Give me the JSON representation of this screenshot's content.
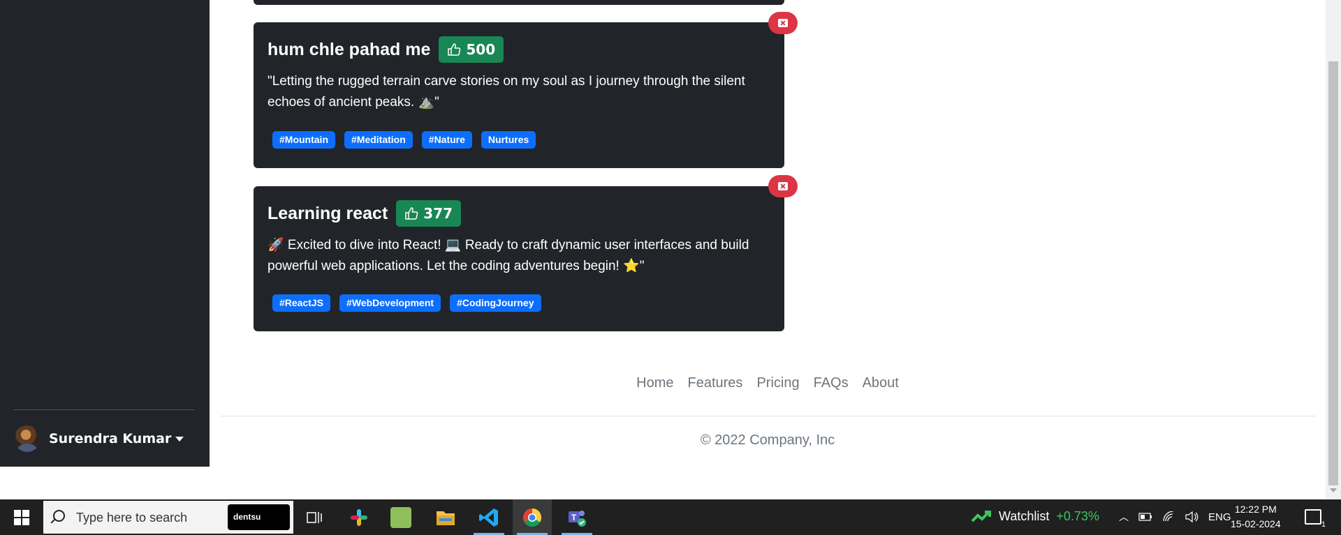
{
  "user": {
    "name": "Surendra Kumar"
  },
  "posts": [
    {
      "title": "hum chle pahad me",
      "likes": "500",
      "body": "\"Letting the rugged terrain carve stories on my soul as I journey through the silent echoes of ancient peaks. ⛰️\"",
      "tags": [
        "#Mountain",
        "#Meditation",
        "#Nature",
        "Nurtures"
      ]
    },
    {
      "title": "Learning react",
      "likes": "377",
      "body": "🚀 Excited to dive into React! 💻 Ready to craft dynamic user interfaces and build powerful web applications. Let the coding adventures begin! ⭐\"",
      "tags": [
        "#ReactJS",
        "#WebDevelopment",
        "#CodingJourney"
      ]
    }
  ],
  "footer": {
    "links": [
      "Home",
      "Features",
      "Pricing",
      "FAQs",
      "About"
    ],
    "copyright": "© 2022 Company, Inc"
  },
  "taskbar": {
    "search_placeholder": "Type here to search",
    "search_brand": "dentsu",
    "watchlist_label": "Watchlist",
    "watchlist_change": "+0.73%",
    "language": "ENG",
    "time": "12:22 PM",
    "date": "15-02-2024",
    "notification_count": "1",
    "apps": [
      "task-view",
      "slack",
      "notepad-plus",
      "file-explorer",
      "vscode",
      "chrome",
      "teams"
    ]
  },
  "colors": {
    "sidebar": "#212529",
    "card": "#212529",
    "likes_badge": "#198754",
    "tag": "#0d6efd",
    "delete": "#dc3545"
  }
}
